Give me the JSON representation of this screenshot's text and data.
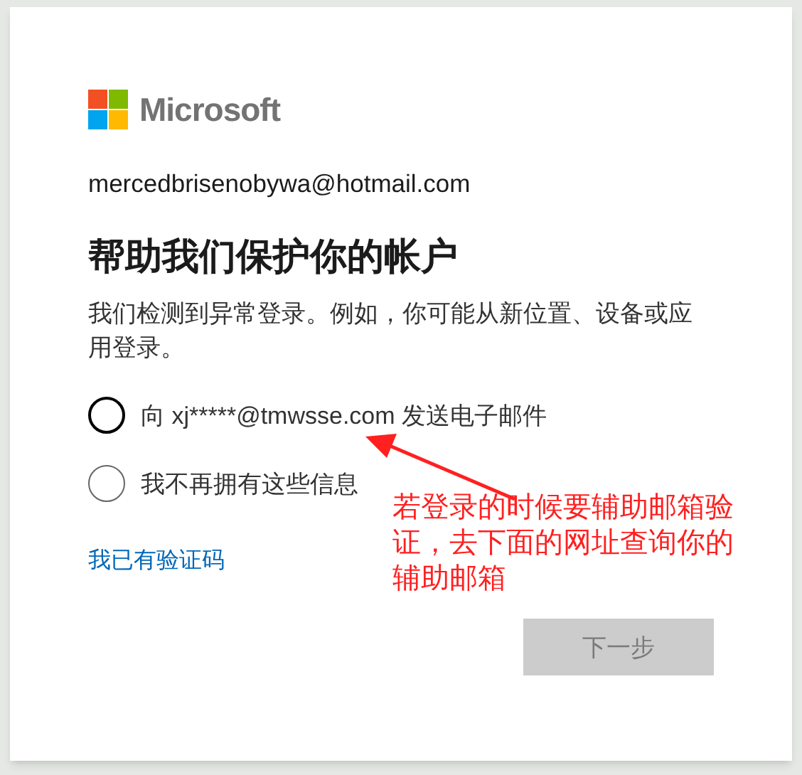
{
  "logo": {
    "text": "Microsoft"
  },
  "account": "mercedbrisenobywa@hotmail.com",
  "title": "帮助我们保护你的帐户",
  "description": "我们检测到异常登录。例如，你可能从新位置、设备或应用登录。",
  "options": [
    {
      "label": "向 xj*****@tmwsse.com 发送电子邮件",
      "selected": false,
      "focused": true
    },
    {
      "label": "我不再拥有这些信息",
      "selected": false,
      "focused": false
    }
  ],
  "link": "我已有验证码",
  "next_button": {
    "label": "下一步",
    "disabled": true
  },
  "annotation": {
    "text": "若登录的时候要辅助邮箱验证，去下面的网址查询你的辅助邮箱"
  }
}
